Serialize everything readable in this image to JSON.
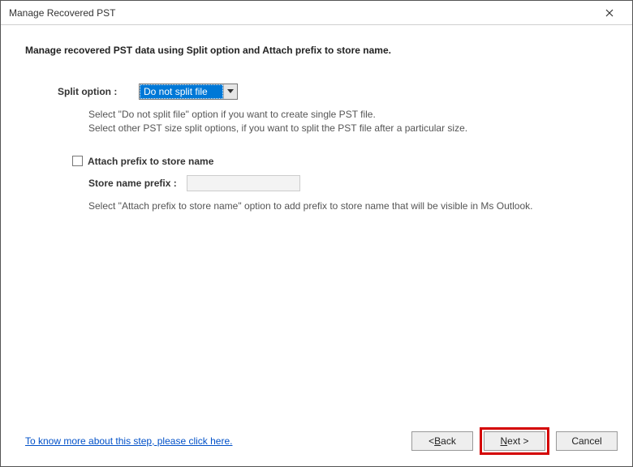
{
  "window": {
    "title": "Manage Recovered PST"
  },
  "heading": "Manage recovered PST data using Split option and Attach prefix to store name.",
  "split": {
    "label": "Split option :",
    "selected": "Do not split file",
    "hint_line1": "Select \"Do not split file\" option if you want to create single PST file.",
    "hint_line2": "Select other PST size split options, if you want to split the PST file after a particular size."
  },
  "prefix": {
    "checkbox_label": "Attach prefix to store name",
    "checked": false,
    "input_label": "Store name prefix :",
    "input_value": "",
    "hint": "Select \"Attach prefix to store name\" option to add prefix to store name that will be visible in Ms Outlook."
  },
  "footer": {
    "help_link": "To know more about this step, please click here.",
    "back_prefix": "< ",
    "back_ul": "B",
    "back_rest": "ack",
    "next_ul": "N",
    "next_rest": "ext >",
    "cancel": "Cancel"
  }
}
